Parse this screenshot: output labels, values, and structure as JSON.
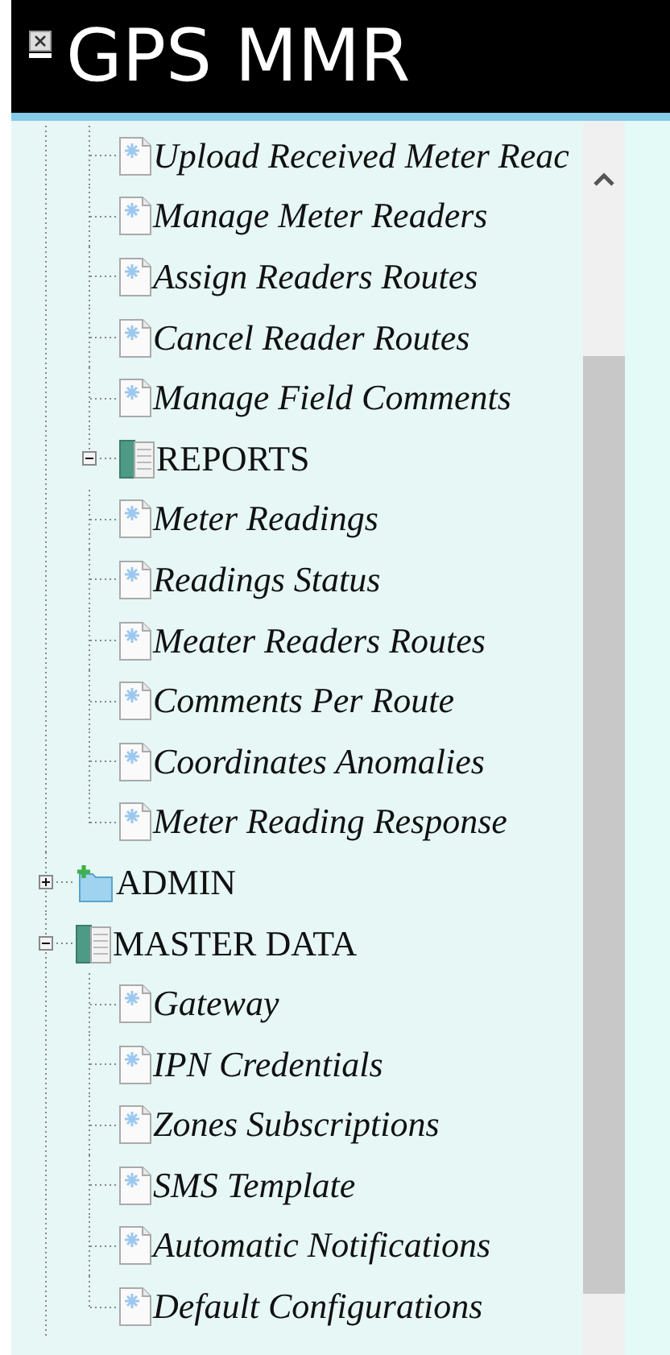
{
  "header": {
    "title": "GPS MMR"
  },
  "tree": [
    {
      "children": [
        {
          "label": "Upload Received Meter Reac"
        },
        {
          "label": "Manage Meter Readers"
        },
        {
          "label": "Assign Readers Routes"
        },
        {
          "label": "Cancel Reader Routes"
        },
        {
          "label": "Manage Field Comments"
        },
        {
          "label": "REPORTS",
          "expanded": true,
          "children": [
            {
              "label": "Meter Readings"
            },
            {
              "label": "Readings Status"
            },
            {
              "label": "Meater Readers Routes"
            },
            {
              "label": "Comments Per Route"
            },
            {
              "label": "Coordinates Anomalies"
            },
            {
              "label": "Meter Reading Response"
            }
          ]
        }
      ]
    },
    {
      "label": "ADMIN",
      "expanded": false
    },
    {
      "label": "MASTER DATA",
      "expanded": true,
      "children": [
        {
          "label": "Gateway"
        },
        {
          "label": "IPN Credentials"
        },
        {
          "label": "Zones Subscriptions"
        },
        {
          "label": "SMS Template"
        },
        {
          "label": "Automatic Notifications"
        },
        {
          "label": "Default Configurations"
        }
      ]
    }
  ]
}
